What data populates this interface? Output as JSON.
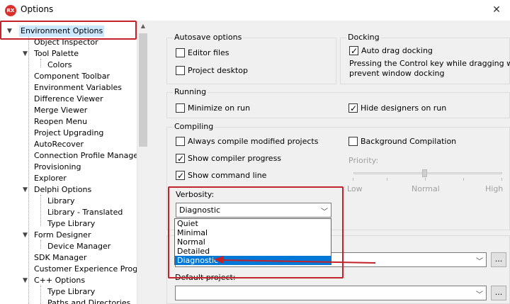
{
  "window": {
    "title": "Options",
    "icon_text": "RX",
    "close_glyph": "✕"
  },
  "tree": {
    "items": [
      {
        "label": "Environment Options",
        "level": 0,
        "expanded": true,
        "selected": true
      },
      {
        "label": "Object Inspector",
        "level": 1
      },
      {
        "label": "Tool Palette",
        "level": 1,
        "expanded": true
      },
      {
        "label": "Colors",
        "level": 2
      },
      {
        "label": "Component Toolbar",
        "level": 1
      },
      {
        "label": "Environment Variables",
        "level": 1
      },
      {
        "label": "Difference Viewer",
        "level": 1
      },
      {
        "label": "Merge Viewer",
        "level": 1
      },
      {
        "label": "Reopen Menu",
        "level": 1
      },
      {
        "label": "Project Upgrading",
        "level": 1
      },
      {
        "label": "AutoRecover",
        "level": 1
      },
      {
        "label": "Connection Profile Manager",
        "level": 1
      },
      {
        "label": "Provisioning",
        "level": 1
      },
      {
        "label": "Explorer",
        "level": 1
      },
      {
        "label": "Delphi Options",
        "level": 1,
        "expanded": true
      },
      {
        "label": "Library",
        "level": 2
      },
      {
        "label": "Library - Translated",
        "level": 2
      },
      {
        "label": "Type Library",
        "level": 2
      },
      {
        "label": "Form Designer",
        "level": 1,
        "expanded": true
      },
      {
        "label": "Device Manager",
        "level": 2
      },
      {
        "label": "SDK Manager",
        "level": 1
      },
      {
        "label": "Customer Experience Program",
        "level": 1
      },
      {
        "label": "C++ Options",
        "level": 1,
        "expanded": true
      },
      {
        "label": "Type Library",
        "level": 2
      },
      {
        "label": "Paths and Directories",
        "level": 2
      }
    ]
  },
  "autosave": {
    "title": "Autosave options",
    "editor_files": {
      "label": "Editor files",
      "checked": false
    },
    "project_desktop": {
      "label": "Project desktop",
      "checked": false
    }
  },
  "docking": {
    "title": "Docking",
    "auto_drag": {
      "label": "Auto drag docking",
      "checked": true
    },
    "note_line1": "Pressing the Control key while dragging will",
    "note_line2": "prevent window docking"
  },
  "running": {
    "title": "Running",
    "minimize": {
      "label": "Minimize on run",
      "checked": false
    },
    "hide_designers": {
      "label": "Hide designers on run",
      "checked": true
    }
  },
  "compiling": {
    "title": "Compiling",
    "always_compile": {
      "label": "Always compile modified projects",
      "checked": false
    },
    "show_progress": {
      "label": "Show compiler progress",
      "checked": true
    },
    "show_cmdline": {
      "label": "Show command line",
      "checked": true
    },
    "background": {
      "label": "Background Compilation",
      "checked": false
    },
    "priority_label": "Priority:",
    "priority_low": "Low",
    "priority_normal": "Normal",
    "priority_high": "High",
    "priority_level": 0.5
  },
  "verbosity": {
    "label": "Verbosity:",
    "value": "Diagnostic",
    "options": [
      "Quiet",
      "Minimal",
      "Normal",
      "Detailed",
      "Diagnostic"
    ],
    "selected_index": 4
  },
  "default_project": {
    "label": "Default project:",
    "value": "",
    "browse": "..."
  },
  "other_browse": "..."
}
